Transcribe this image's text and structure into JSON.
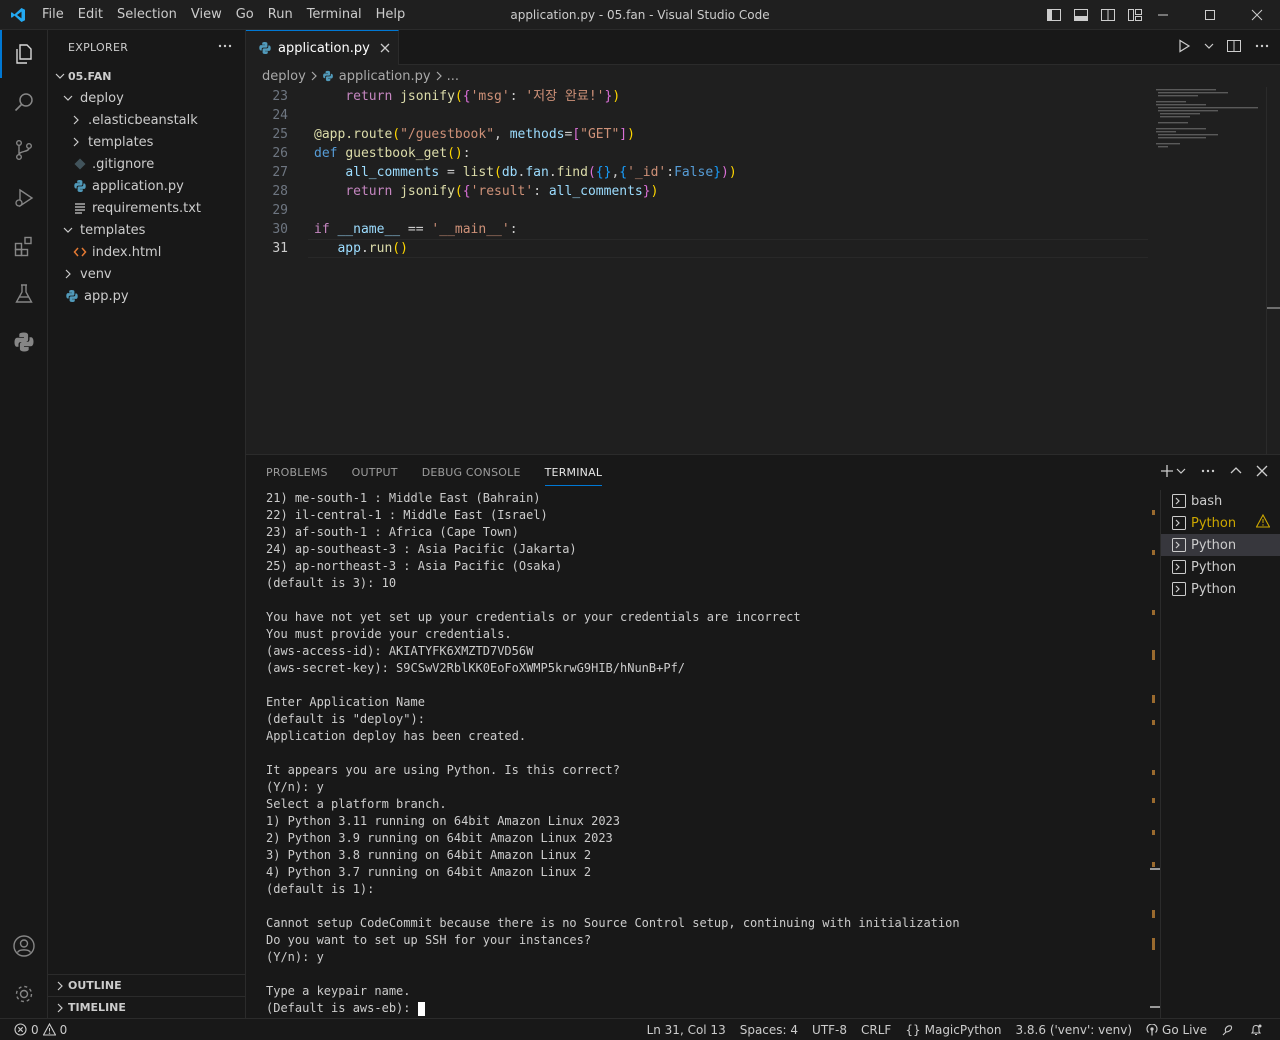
{
  "window": {
    "title": "application.py - 05.fan - Visual Studio Code",
    "menu": [
      "File",
      "Edit",
      "Selection",
      "View",
      "Go",
      "Run",
      "Terminal",
      "Help"
    ]
  },
  "sidebar": {
    "header": "EXPLORER",
    "root": "05.FAN",
    "items": [
      {
        "label": "deploy",
        "kind": "folder-open",
        "depth": 1
      },
      {
        "label": ".elasticbeanstalk",
        "kind": "folder",
        "depth": 2
      },
      {
        "label": "templates",
        "kind": "folder",
        "depth": 2
      },
      {
        "label": ".gitignore",
        "kind": "gitignore",
        "depth": 2
      },
      {
        "label": "application.py",
        "kind": "python",
        "depth": 2
      },
      {
        "label": "requirements.txt",
        "kind": "text",
        "depth": 2
      },
      {
        "label": "templates",
        "kind": "folder-open",
        "depth": 1
      },
      {
        "label": "index.html",
        "kind": "html",
        "depth": 2
      },
      {
        "label": "venv",
        "kind": "folder",
        "depth": 1
      },
      {
        "label": "app.py",
        "kind": "python",
        "depth": 1
      }
    ],
    "outline": "OUTLINE",
    "timeline": "TIMELINE"
  },
  "editor": {
    "tab_label": "application.py",
    "breadcrumb": [
      "deploy",
      "application.py",
      "..."
    ],
    "lines": [
      {
        "num": "23",
        "indent": "    ",
        "tokens": [
          [
            "kw",
            "return "
          ],
          [
            "fn",
            "jsonify"
          ],
          [
            "br1",
            "("
          ],
          [
            "br2",
            "{"
          ],
          [
            "str",
            "'msg'"
          ],
          [
            "plain",
            ": "
          ],
          [
            "str",
            "'저장 완료!'"
          ],
          [
            "br2",
            "}"
          ],
          [
            "br1",
            ")"
          ]
        ]
      },
      {
        "num": "24",
        "indent": "",
        "tokens": []
      },
      {
        "num": "25",
        "indent": "",
        "tokens": [
          [
            "dec",
            "@app.route"
          ],
          [
            "br1",
            "("
          ],
          [
            "str",
            "\"/guestbook\""
          ],
          [
            "plain",
            ", "
          ],
          [
            "var",
            "methods"
          ],
          [
            "plain",
            "="
          ],
          [
            "br2",
            "["
          ],
          [
            "str",
            "\"GET\""
          ],
          [
            "br2",
            "]"
          ],
          [
            "br1",
            ")"
          ]
        ]
      },
      {
        "num": "26",
        "indent": "",
        "tokens": [
          [
            "kw2",
            "def "
          ],
          [
            "fn",
            "guestbook_get"
          ],
          [
            "br1",
            "("
          ],
          [
            "br1",
            ")"
          ],
          [
            "plain",
            ":"
          ]
        ]
      },
      {
        "num": "27",
        "indent": "    ",
        "tokens": [
          [
            "var",
            "all_comments"
          ],
          [
            "plain",
            " = "
          ],
          [
            "fn",
            "list"
          ],
          [
            "br1",
            "("
          ],
          [
            "var",
            "db"
          ],
          [
            "plain",
            "."
          ],
          [
            "var",
            "fan"
          ],
          [
            "plain",
            "."
          ],
          [
            "fn",
            "find"
          ],
          [
            "br2",
            "("
          ],
          [
            "br3",
            "{}"
          ],
          [
            "plain",
            ","
          ],
          [
            "br3",
            "{"
          ],
          [
            "str",
            "'_id'"
          ],
          [
            "plain",
            ":"
          ],
          [
            "kw2",
            "False"
          ],
          [
            "br3",
            "}"
          ],
          [
            "br2",
            ")"
          ],
          [
            "br1",
            ")"
          ]
        ]
      },
      {
        "num": "28",
        "indent": "    ",
        "tokens": [
          [
            "kw",
            "return "
          ],
          [
            "fn",
            "jsonify"
          ],
          [
            "br1",
            "("
          ],
          [
            "br2",
            "{"
          ],
          [
            "str",
            "'result'"
          ],
          [
            "plain",
            ": "
          ],
          [
            "var",
            "all_comments"
          ],
          [
            "br2",
            "}"
          ],
          [
            "br1",
            ")"
          ]
        ]
      },
      {
        "num": "29",
        "indent": "",
        "tokens": []
      },
      {
        "num": "30",
        "indent": "",
        "tokens": [
          [
            "kw",
            "if "
          ],
          [
            "var",
            "__name__"
          ],
          [
            "plain",
            " == "
          ],
          [
            "str",
            "'__main__'"
          ],
          [
            "plain",
            ":"
          ]
        ]
      },
      {
        "num": "31",
        "indent": "   ",
        "tokens": [
          [
            "var",
            "app"
          ],
          [
            "plain",
            "."
          ],
          [
            "fn",
            "run"
          ],
          [
            "br1",
            "("
          ],
          [
            "br1",
            ")"
          ]
        ],
        "current": true
      }
    ]
  },
  "panel": {
    "tabs": [
      "PROBLEMS",
      "OUTPUT",
      "DEBUG CONSOLE",
      "TERMINAL"
    ],
    "active_tab": "TERMINAL",
    "terminal_lines": [
      "21) me-south-1 : Middle East (Bahrain)",
      "22) il-central-1 : Middle East (Israel)",
      "23) af-south-1 : Africa (Cape Town)",
      "24) ap-southeast-3 : Asia Pacific (Jakarta)",
      "25) ap-northeast-3 : Asia Pacific (Osaka)",
      "(default is 3): 10",
      "",
      "You have not yet set up your credentials or your credentials are incorrect",
      "You must provide your credentials.",
      "(aws-access-id): AKIATYFK6XMZTD7VD56W",
      "(aws-secret-key): S9CSwV2RblKK0EoFoXWMP5krwG9HIB/hNunB+Pf/",
      "",
      "Enter Application Name",
      "(default is \"deploy\"):",
      "Application deploy has been created.",
      "",
      "It appears you are using Python. Is this correct?",
      "(Y/n): y",
      "Select a platform branch.",
      "1) Python 3.11 running on 64bit Amazon Linux 2023",
      "2) Python 3.9 running on 64bit Amazon Linux 2023",
      "3) Python 3.8 running on 64bit Amazon Linux 2",
      "4) Python 3.7 running on 64bit Amazon Linux 2",
      "(default is 1):",
      "",
      "Cannot setup CodeCommit because there is no Source Control setup, continuing with initialization",
      "Do you want to set up SSH for your instances?",
      "(Y/n): y",
      "",
      "Type a keypair name.",
      "(Default is aws-eb): "
    ],
    "terminals": [
      {
        "label": "bash",
        "warn": false,
        "selected": false
      },
      {
        "label": "Python",
        "warn": true,
        "selected": false
      },
      {
        "label": "Python",
        "warn": false,
        "selected": true
      },
      {
        "label": "Python",
        "warn": false,
        "selected": false
      },
      {
        "label": "Python",
        "warn": false,
        "selected": false
      }
    ]
  },
  "statusbar": {
    "errors": "0",
    "warnings": "0",
    "position": "Ln 31, Col 13",
    "spaces": "Spaces: 4",
    "encoding": "UTF-8",
    "eol": "CRLF",
    "language": "MagicPython",
    "interpreter": "3.8.6 ('venv': venv)",
    "golive": "Go Live"
  },
  "colors": {
    "accent": "#0078d4",
    "python_icon": "#519aba",
    "html_icon": "#e37933",
    "warning": "#cca700"
  }
}
